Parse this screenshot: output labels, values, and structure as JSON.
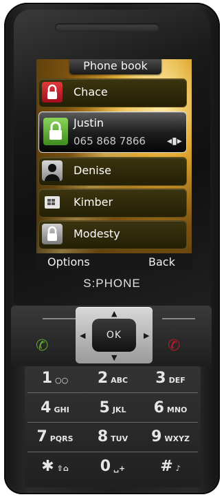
{
  "screen": {
    "title": "Phone book",
    "contacts": [
      {
        "name": "Chace",
        "icon": "red-lock-icon"
      },
      {
        "name": "Justin",
        "number": "065 868 7866",
        "icon": "green-lock-icon",
        "selected": true
      },
      {
        "name": "Denise",
        "icon": "person-silhouette-icon"
      },
      {
        "name": "Kimber",
        "icon": "sim-card-icon"
      },
      {
        "name": "Modesty",
        "icon": "lock-icon"
      }
    ],
    "softkeys": {
      "left": "Options",
      "right": "Back"
    }
  },
  "brand": "S:PHONE",
  "nav": {
    "ok": "OK"
  },
  "keypad": [
    {
      "digit": "1",
      "letters": "○○"
    },
    {
      "digit": "2",
      "letters": "ABC"
    },
    {
      "digit": "3",
      "letters": "DEF"
    },
    {
      "digit": "4",
      "letters": "GHI"
    },
    {
      "digit": "5",
      "letters": "JKL"
    },
    {
      "digit": "6",
      "letters": "MNO"
    },
    {
      "digit": "7",
      "letters": "PQRS"
    },
    {
      "digit": "8",
      "letters": "TUV"
    },
    {
      "digit": "9",
      "letters": "WXYZ"
    },
    {
      "digit": "✱",
      "letters": "⇧⌂"
    },
    {
      "digit": "0",
      "letters": "␣+"
    },
    {
      "digit": "#",
      "letters": "♪"
    }
  ],
  "colors": {
    "accent_green": "#5fa832",
    "accent_red": "#c0182b"
  }
}
